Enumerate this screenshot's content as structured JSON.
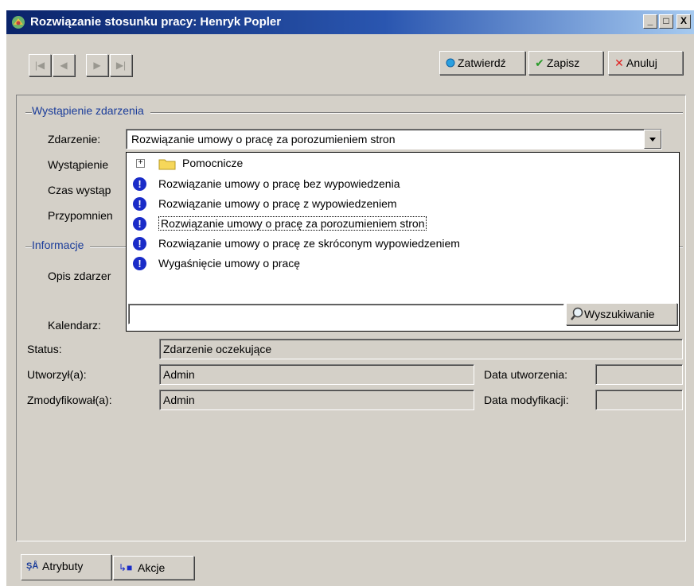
{
  "window": {
    "title": "Rozwiązanie stosunku pracy: Henryk Popler",
    "controls": {
      "minimize": "_",
      "maximize": "□",
      "close": "X"
    }
  },
  "toolbar": {
    "nav": {
      "first": "|◀",
      "prev": "◀",
      "next": "▶",
      "last": "▶|"
    },
    "confirm_label": "Zatwierdź",
    "save_label": "Zapisz",
    "cancel_label": "Anuluj"
  },
  "section_event": {
    "title": "Wystąpienie zdarzenia",
    "event_label": "Zdarzenie:",
    "event_value": "Rozwiązanie umowy o pracę za porozumieniem stron",
    "occurrence_label": "Wystąpienie",
    "time_label": "Czas wystąp",
    "reminder_label": "Przypomnien"
  },
  "section_info": {
    "title": "Informacje",
    "description_label": "Opis zdarzer",
    "calendar_label": "Kalendarz:",
    "status_label": "Status:",
    "status_value": "Zdarzenie oczekujące",
    "created_by_label": "Utworzył(a):",
    "created_by_value": "Admin",
    "created_date_label": "Data utworzenia:",
    "created_date_value": "",
    "modified_by_label": "Zmodyfikował(a):",
    "modified_by_value": "Admin",
    "modified_date_label": "Data modyfikacji:",
    "modified_date_value": ""
  },
  "dropdown": {
    "folder": {
      "label": "Pomocnicze",
      "expander": "+"
    },
    "items": [
      {
        "label": "Rozwiązanie umowy o pracę bez wypowiedzenia"
      },
      {
        "label": "Rozwiązanie umowy o pracę z wypowiedzeniem"
      },
      {
        "label": "Rozwiązanie umowy o pracę za porozumieniem stron"
      },
      {
        "label": "Rozwiązanie umowy o pracę ze skróconym wypowiedzeniem"
      },
      {
        "label": "Wygaśnięcie umowy o pracę"
      }
    ],
    "selected_index": 2,
    "search_value": "",
    "search_button": "Wyszukiwanie",
    "item_icon": "!"
  },
  "tabs": [
    {
      "label": "Atrybuty",
      "icon": "attributes-icon",
      "active": true
    },
    {
      "label": "Akcje",
      "icon": "actions-icon",
      "active": false
    }
  ],
  "colors": {
    "accent": "#1a3c9a",
    "titlebar": "#0a246a",
    "info_icon": "#1a2cc8",
    "folder": "#f6d75a"
  }
}
